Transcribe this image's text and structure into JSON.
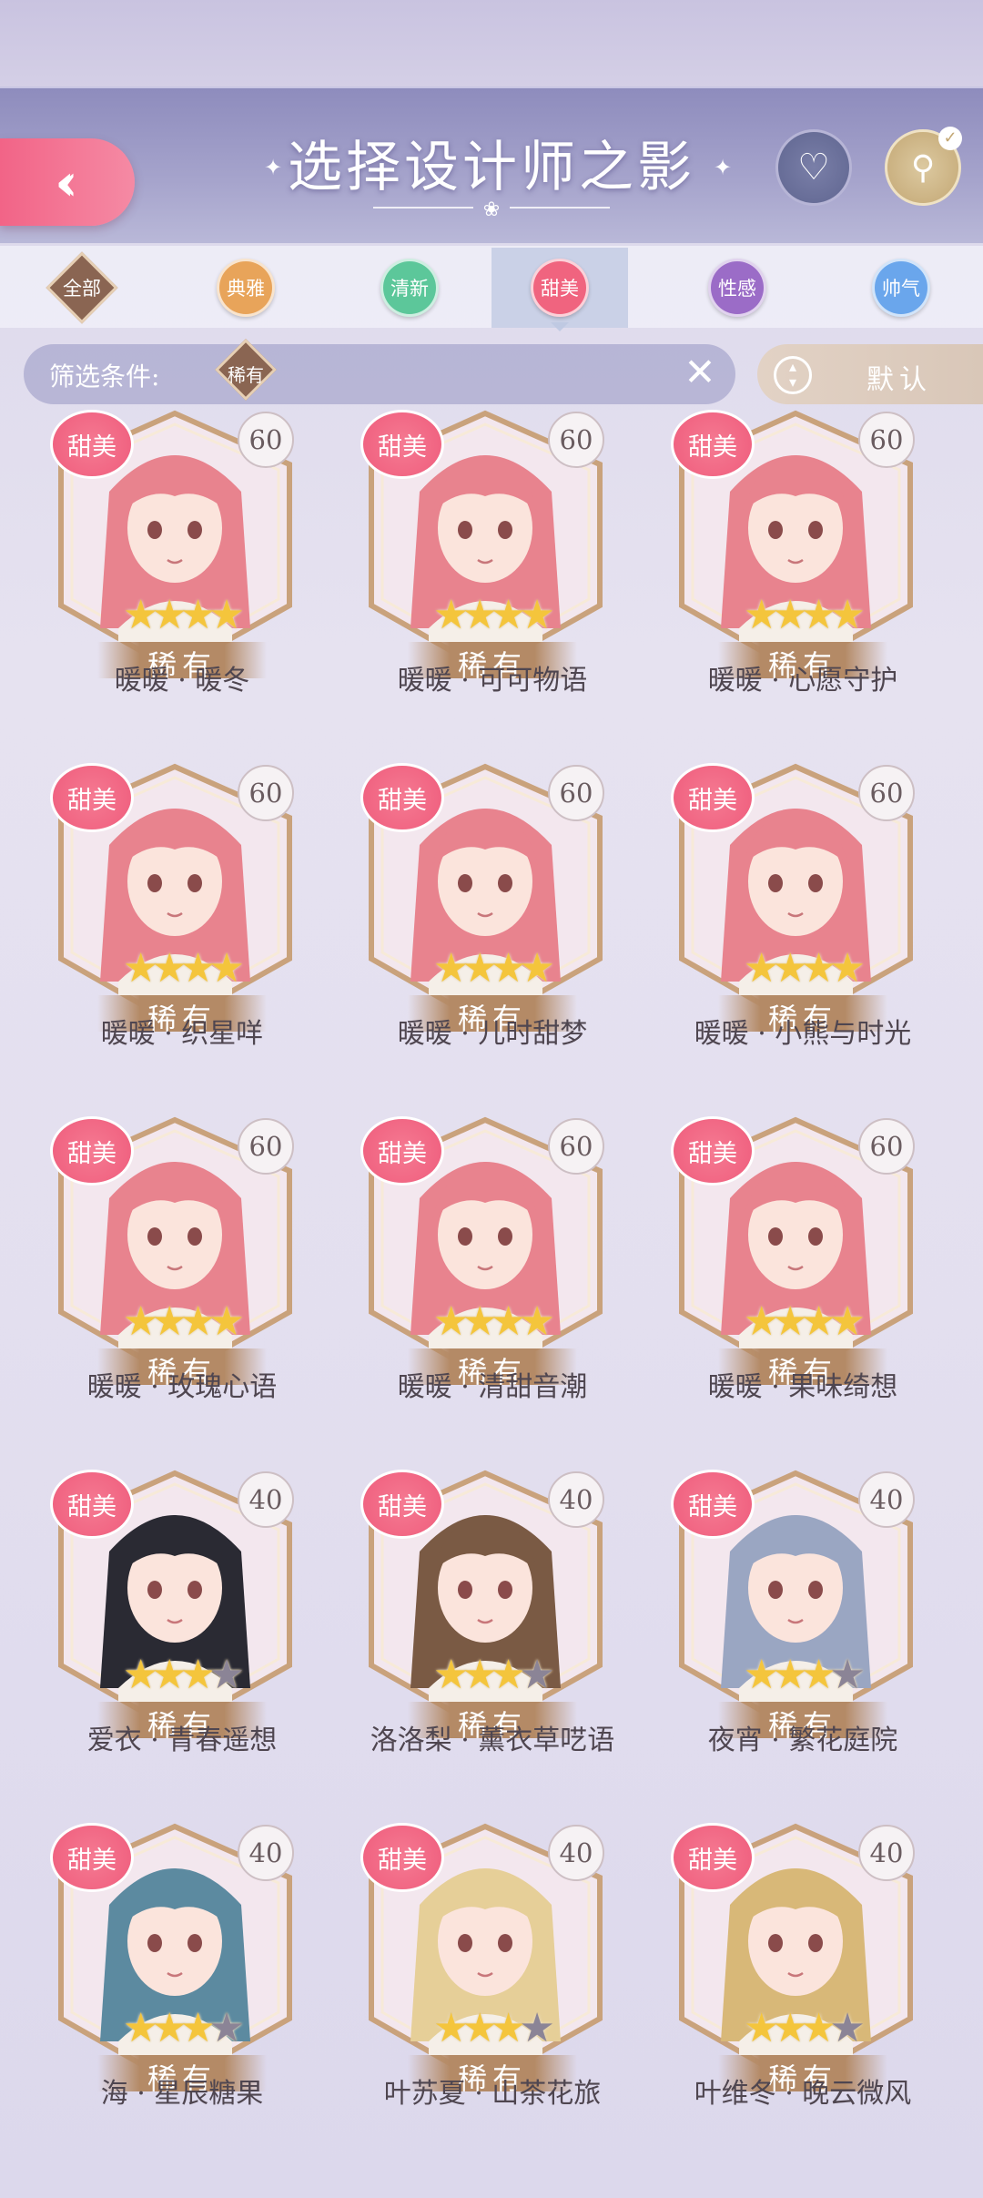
{
  "header": {
    "title": "选择设计师之影",
    "back_icon": "double-chevron-left-icon",
    "favorite_icon": "heart-icon",
    "search_icon": "magnifier-check-icon"
  },
  "tabs": [
    {
      "label": "全部",
      "shape": "diamond",
      "color": "#8a6552",
      "active": false
    },
    {
      "label": "典雅",
      "shape": "circle",
      "color": "#e8a45a",
      "active": false
    },
    {
      "label": "清新",
      "shape": "circle",
      "color": "#5cc79a",
      "active": false
    },
    {
      "label": "甜美",
      "shape": "circle",
      "color": "#f0647f",
      "active": true
    },
    {
      "label": "性感",
      "shape": "circle",
      "color": "#9b6cc7",
      "active": false
    },
    {
      "label": "帅气",
      "shape": "circle",
      "color": "#6aa6ec",
      "active": false
    }
  ],
  "filter": {
    "label": "筛选条件:",
    "tag": "稀有",
    "clear_icon": "close-icon"
  },
  "sort": {
    "label": "默认",
    "icon": "sort-updown-icon"
  },
  "cards": [
    {
      "name": "暖暖 · 暖冬",
      "badge": "甜美",
      "level": "60",
      "stars": 4,
      "max_stars": 4,
      "rarity": "稀有",
      "hair": "#e8838e"
    },
    {
      "name": "暖暖 · 可可物语",
      "badge": "甜美",
      "level": "60",
      "stars": 4,
      "max_stars": 4,
      "rarity": "稀有",
      "hair": "#e8838e"
    },
    {
      "name": "暖暖 · 心愿守护",
      "badge": "甜美",
      "level": "60",
      "stars": 4,
      "max_stars": 4,
      "rarity": "稀有",
      "hair": "#e8838e"
    },
    {
      "name": "暖暖 · 织星咩",
      "badge": "甜美",
      "level": "60",
      "stars": 4,
      "max_stars": 4,
      "rarity": "稀有",
      "hair": "#e8838e"
    },
    {
      "name": "暖暖 · 儿时甜梦",
      "badge": "甜美",
      "level": "60",
      "stars": 4,
      "max_stars": 4,
      "rarity": "稀有",
      "hair": "#e8838e"
    },
    {
      "name": "暖暖 · 小熊与时光",
      "badge": "甜美",
      "level": "60",
      "stars": 4,
      "max_stars": 4,
      "rarity": "稀有",
      "hair": "#e8838e"
    },
    {
      "name": "暖暖 · 玫瑰心语",
      "badge": "甜美",
      "level": "60",
      "stars": 4,
      "max_stars": 4,
      "rarity": "稀有",
      "hair": "#e8838e"
    },
    {
      "name": "暖暖 · 清甜音潮",
      "badge": "甜美",
      "level": "60",
      "stars": 4,
      "max_stars": 4,
      "rarity": "稀有",
      "hair": "#e8838e"
    },
    {
      "name": "暖暖 · 果味绮想",
      "badge": "甜美",
      "level": "60",
      "stars": 4,
      "max_stars": 4,
      "rarity": "稀有",
      "hair": "#e8838e"
    },
    {
      "name": "爱衣 · 青春遥想",
      "badge": "甜美",
      "level": "40",
      "stars": 3,
      "max_stars": 4,
      "rarity": "稀有",
      "hair": "#2a2a33"
    },
    {
      "name": "洛洛梨 · 薰衣草呓语",
      "badge": "甜美",
      "level": "40",
      "stars": 3,
      "max_stars": 4,
      "rarity": "稀有",
      "hair": "#7a5a44"
    },
    {
      "name": "夜宵 · 繁花庭院",
      "badge": "甜美",
      "level": "40",
      "stars": 3,
      "max_stars": 4,
      "rarity": "稀有",
      "hair": "#9aa6c2"
    },
    {
      "name": "海 · 星辰糖果",
      "badge": "甜美",
      "level": "40",
      "stars": 3,
      "max_stars": 4,
      "rarity": "稀有",
      "hair": "#5c8aa0"
    },
    {
      "name": "叶苏夏 · 山茶花旅",
      "badge": "甜美",
      "level": "40",
      "stars": 3,
      "max_stars": 4,
      "rarity": "稀有",
      "hair": "#e6cf98"
    },
    {
      "name": "叶维冬 · 晚云微风",
      "badge": "甜美",
      "level": "40",
      "stars": 3,
      "max_stars": 4,
      "rarity": "稀有",
      "hair": "#d8b878"
    }
  ]
}
